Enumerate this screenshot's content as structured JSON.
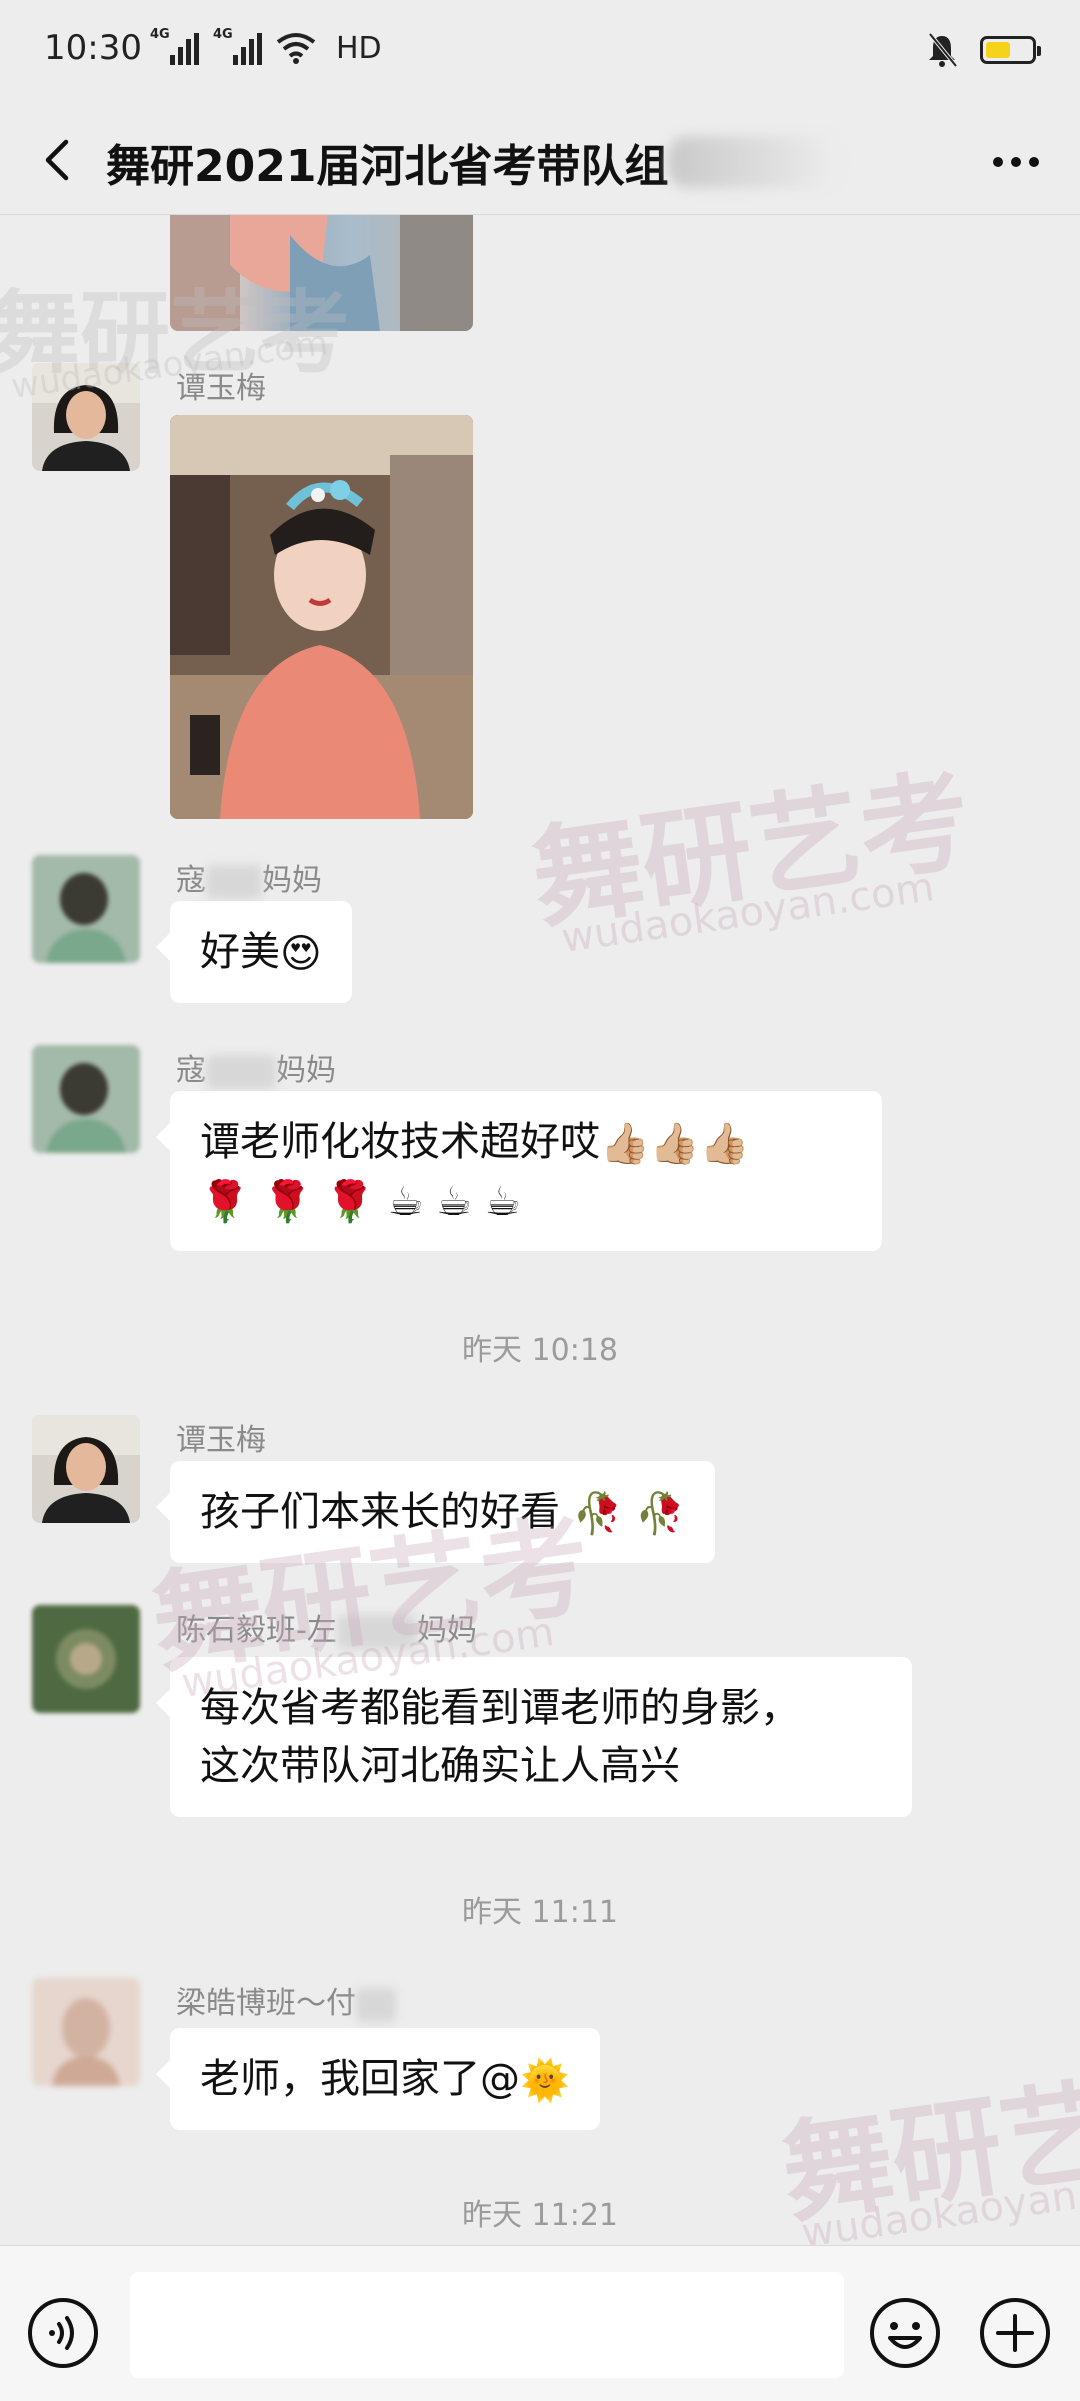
{
  "status_bar": {
    "time": "10:30",
    "signal_label": "4G",
    "hd_label": "HD",
    "battery_level": 0.55,
    "battery_color": "#f7d21a"
  },
  "header": {
    "back_icon": "chevron-left-icon",
    "title": "舞研2021届河北省考带队组",
    "more_icon": "more-horizontal-icon"
  },
  "messages": [
    {
      "kind": "image",
      "sender": "",
      "avatar": "hidden"
    },
    {
      "kind": "image",
      "sender": "谭玉梅",
      "avatar": "woman-portrait"
    },
    {
      "kind": "text",
      "sender_prefix": "寇",
      "sender_suffix": "妈妈",
      "text": "好美",
      "emojis": [
        "😍"
      ]
    },
    {
      "kind": "text",
      "sender_prefix": "寇",
      "sender_suffix": "妈妈",
      "text": "谭老师化妆技术超好哎",
      "emojis_line1": [
        "👍🏼",
        "👍🏼",
        "👍🏼"
      ],
      "emojis_line2": [
        "🌹",
        "🌹",
        "🌹",
        "☕",
        "☕",
        "☕"
      ]
    },
    {
      "kind": "timestamp",
      "text": "昨天 10:18"
    },
    {
      "kind": "text",
      "sender": "谭玉梅",
      "text": "孩子们本来长的好看",
      "emojis": [
        "🥀",
        "🥀"
      ]
    },
    {
      "kind": "text",
      "sender_prefix": "陈石毅班-左",
      "sender_suffix": "妈妈",
      "line1": "每次省考都能看到谭老师的身影，",
      "line2": "这次带队河北确实让人高兴"
    },
    {
      "kind": "timestamp",
      "text": "昨天 11:11"
    },
    {
      "kind": "text",
      "sender": "梁皓博班～付",
      "text": "老师，我回家了@",
      "emojis": [
        "🌞"
      ]
    },
    {
      "kind": "timestamp",
      "text": "昨天 11:21"
    }
  ],
  "watermark": {
    "brand": "舞研艺考",
    "url": "wudaokaoyan.com"
  },
  "input_bar": {
    "voice_icon": "voice-icon",
    "placeholder": "",
    "emoji_icon": "emoji-icon",
    "plus_icon": "plus-icon"
  }
}
